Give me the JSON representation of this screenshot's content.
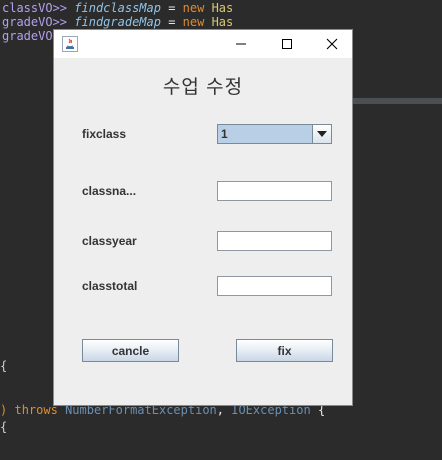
{
  "ide": {
    "line1": {
      "type": "classVO>>",
      "var": "findclassMap",
      "eq": " = ",
      "kw": "new",
      "cls": " Has"
    },
    "line2": {
      "type": "gradeVO>>",
      "var": "findgradeMap",
      "eq": " = ",
      "kw": "new",
      "cls": " Has"
    },
    "line3": {
      "type": "gradeVO"
    },
    "throws_line": {
      "kw": "throws",
      "exc1": "NumberFormatException",
      "sep": ", ",
      "exc2": "IOException",
      "brace": " {"
    }
  },
  "dialog": {
    "heading": "수업 수정",
    "fields": [
      {
        "label": "fixclass"
      },
      {
        "label": "classna..."
      },
      {
        "label": "classyear"
      },
      {
        "label": "classtotal"
      }
    ],
    "combo_value": "1",
    "cancel_label": "cancle",
    "fix_label": "fix"
  },
  "colors": {
    "dialog_bg": "#eeeeee",
    "combo_bg": "#b8cfe5",
    "ide_bg": "#2b2b2b"
  }
}
